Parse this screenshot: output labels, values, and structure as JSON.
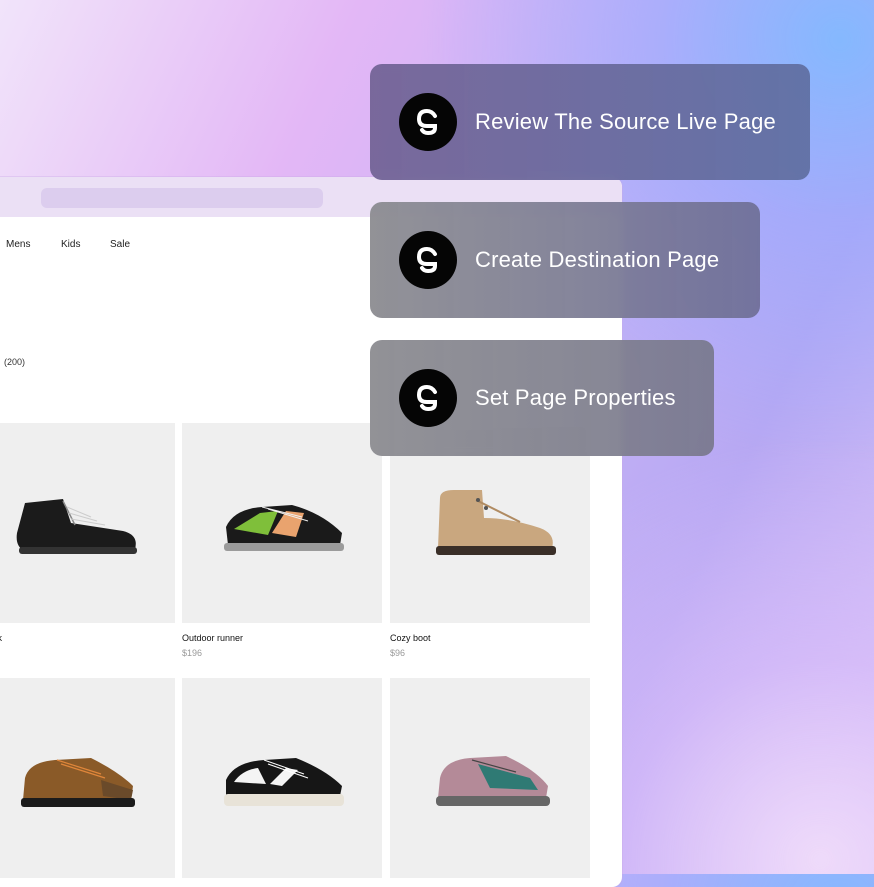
{
  "nav": {
    "items": [
      "Mens",
      "Kids",
      "Sale"
    ]
  },
  "listing": {
    "count": "(200)"
  },
  "products": [
    {
      "name": "n book",
      "price": "",
      "image": "black-hiking-boot"
    },
    {
      "name": "Outdoor runner",
      "price": "$196",
      "image": "green-trail-runner"
    },
    {
      "name": "Cozy boot",
      "price": "$96",
      "image": "tan-suede-boot"
    },
    {
      "name": "",
      "price": "",
      "image": "brown-hiking-shoe"
    },
    {
      "name": "",
      "price": "",
      "image": "black-white-runner"
    },
    {
      "name": "",
      "price": "",
      "image": "pink-teal-hiker"
    }
  ],
  "steps": [
    {
      "label": "Review The Source Live Page",
      "icon": "g-logo-icon"
    },
    {
      "label": "Create Destination Page",
      "icon": "g-logo-icon"
    },
    {
      "label": "Set Page Properties",
      "icon": "g-logo-icon"
    }
  ]
}
